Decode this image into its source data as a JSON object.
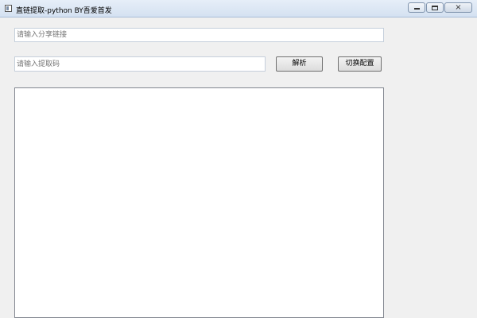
{
  "window": {
    "title": "直链提取-python BY吾爱首发",
    "icon": "app-window-icon",
    "controls": {
      "minimize": "minimize-icon",
      "maximize": "maximize-icon",
      "close": "×"
    }
  },
  "form": {
    "share_link": {
      "placeholder": "请输入分享链接",
      "value": ""
    },
    "extract_code": {
      "placeholder": "请输入提取码",
      "value": ""
    },
    "parse_button": "解析",
    "switch_config_button": "切换配置"
  },
  "output": {
    "text": ""
  }
}
